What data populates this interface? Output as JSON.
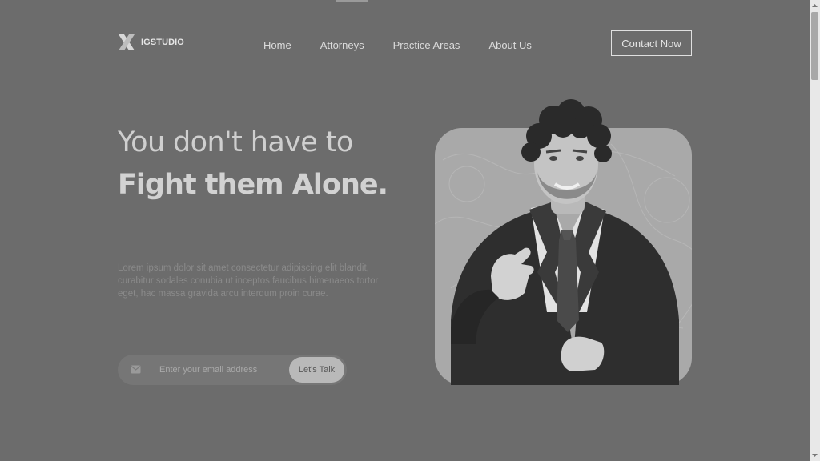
{
  "brand": {
    "logo_text": "IGSTUDIO",
    "logo_icon": "x-logo-icon"
  },
  "nav": {
    "items": [
      {
        "label": "Home"
      },
      {
        "label": "Attorneys"
      },
      {
        "label": "Practice Areas"
      },
      {
        "label": "About Us"
      }
    ],
    "contact_label": "Contact Now"
  },
  "hero": {
    "headline_light": "You don't have to",
    "headline_bold": "Fight them Alone.",
    "description": "Lorem ipsum dolor sit amet consectetur adipiscing elit blandit, curabitur sodales conubia ut inceptos faucibus himenaeos tortor eget, hac massa gravida arcu interdum proin curae.",
    "email_placeholder": "Enter your email address",
    "email_value": "",
    "email_icon": "mail-icon",
    "cta_label": "Let's Talk",
    "image": "attorney-portrait"
  },
  "scrollbar": {
    "position": 0.0
  },
  "colors": {
    "background": "#6c6c6c",
    "card": "#a9a9a9",
    "accent_button": "#b9b9b9",
    "text_light": "#dcdcdc"
  }
}
